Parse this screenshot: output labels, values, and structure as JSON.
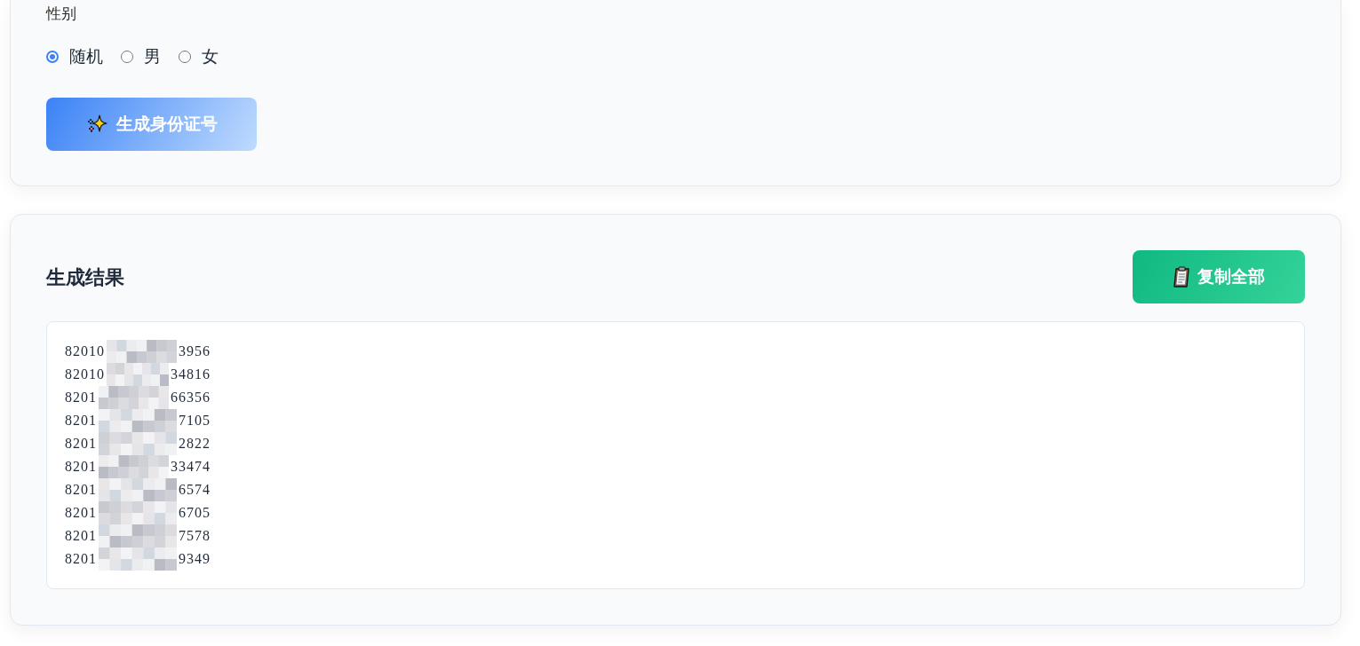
{
  "gender": {
    "label": "性别",
    "options": [
      {
        "label": "随机",
        "selected": true
      },
      {
        "label": "男",
        "selected": false
      },
      {
        "label": "女",
        "selected": false
      }
    ]
  },
  "generate_button": {
    "label": "生成身份证号"
  },
  "results": {
    "title": "生成结果",
    "copy_button": {
      "label": "复制全部"
    },
    "rows": [
      {
        "prefix": "82010",
        "suffix": "3956"
      },
      {
        "prefix": "82010",
        "suffix": "34816"
      },
      {
        "prefix": "8201",
        "suffix": "66356"
      },
      {
        "prefix": "8201",
        "suffix": "7105"
      },
      {
        "prefix": "8201",
        "suffix": "2822"
      },
      {
        "prefix": "8201",
        "suffix": "33474"
      },
      {
        "prefix": "8201",
        "suffix": "6574"
      },
      {
        "prefix": "8201",
        "suffix": "6705"
      },
      {
        "prefix": "8201",
        "suffix": "7578"
      },
      {
        "prefix": "8201",
        "suffix": "9349"
      }
    ]
  }
}
